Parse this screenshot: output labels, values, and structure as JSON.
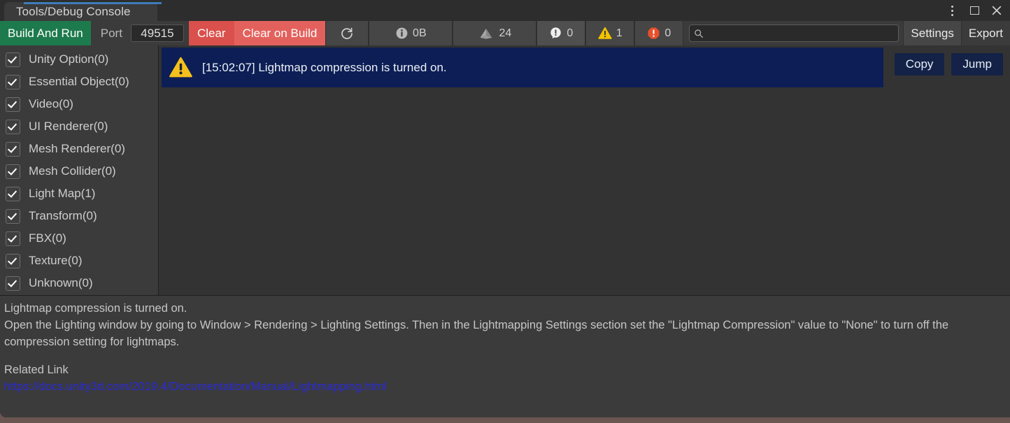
{
  "window": {
    "tab_title": "Tools/Debug Console",
    "controls": {
      "menu": "kebab-menu-icon",
      "maximize": "maximize-icon",
      "close": "close-icon"
    },
    "accent_color": "#3f7cb8"
  },
  "toolbar": {
    "build_and_run": "Build And Run",
    "build_and_run_color": "#1d7a4c",
    "port_label": "Port",
    "port_value": "49515",
    "clear": "Clear",
    "clear_color": "#d9504c",
    "clear_on_build": "Clear on Build",
    "clear_on_build_color": "#e3615d",
    "refresh_icon": "refresh-icon",
    "size_icon": "info-icon",
    "size_value": "0B",
    "mesh_icon": "mesh-icon",
    "mesh_value": "24",
    "message_icon": "message-icon",
    "message_count": "0",
    "warning_icon": "warning-icon",
    "warning_count": "1",
    "warning_color": "#f2c200",
    "error_icon": "error-icon",
    "error_count": "0",
    "error_color": "#e8502a",
    "search_icon": "search-icon",
    "search_value": "",
    "search_placeholder": "",
    "settings": "Settings",
    "export": "Export"
  },
  "sidebar": {
    "items": [
      {
        "label": "Unity Option(0)",
        "checked": true
      },
      {
        "label": "Essential Object(0)",
        "checked": true
      },
      {
        "label": "Video(0)",
        "checked": true
      },
      {
        "label": "UI Renderer(0)",
        "checked": true
      },
      {
        "label": "Mesh Renderer(0)",
        "checked": true
      },
      {
        "label": "Mesh Collider(0)",
        "checked": true
      },
      {
        "label": "Light Map(1)",
        "checked": true
      },
      {
        "label": "Transform(0)",
        "checked": true
      },
      {
        "label": "FBX(0)",
        "checked": true
      },
      {
        "label": "Texture(0)",
        "checked": true
      },
      {
        "label": "Unknown(0)",
        "checked": true
      }
    ]
  },
  "log": {
    "rows": [
      {
        "icon": "warning-icon",
        "timestamp": "[15:02:07]",
        "message": "Lightmap compression is turned on.",
        "text": "[15:02:07] Lightmap compression is turned on.",
        "selected": true,
        "selected_color": "#0c1e55"
      }
    ],
    "copy_label": "Copy",
    "jump_label": "Jump"
  },
  "detail": {
    "line1": "Lightmap compression is turned on.",
    "line2": "Open the Lighting window by going to Window > Rendering > Lighting Settings. Then in the Lightmapping Settings section set the \"Lightmap Compression\" value to \"None\" to turn off the compression setting for lightmaps.",
    "related_link_label": "Related Link",
    "related_link_url": "https://docs.unity3d.com/2019.4/Documentation/Manual/Lightmapping.html",
    "link_color": "#2a2ad8"
  }
}
